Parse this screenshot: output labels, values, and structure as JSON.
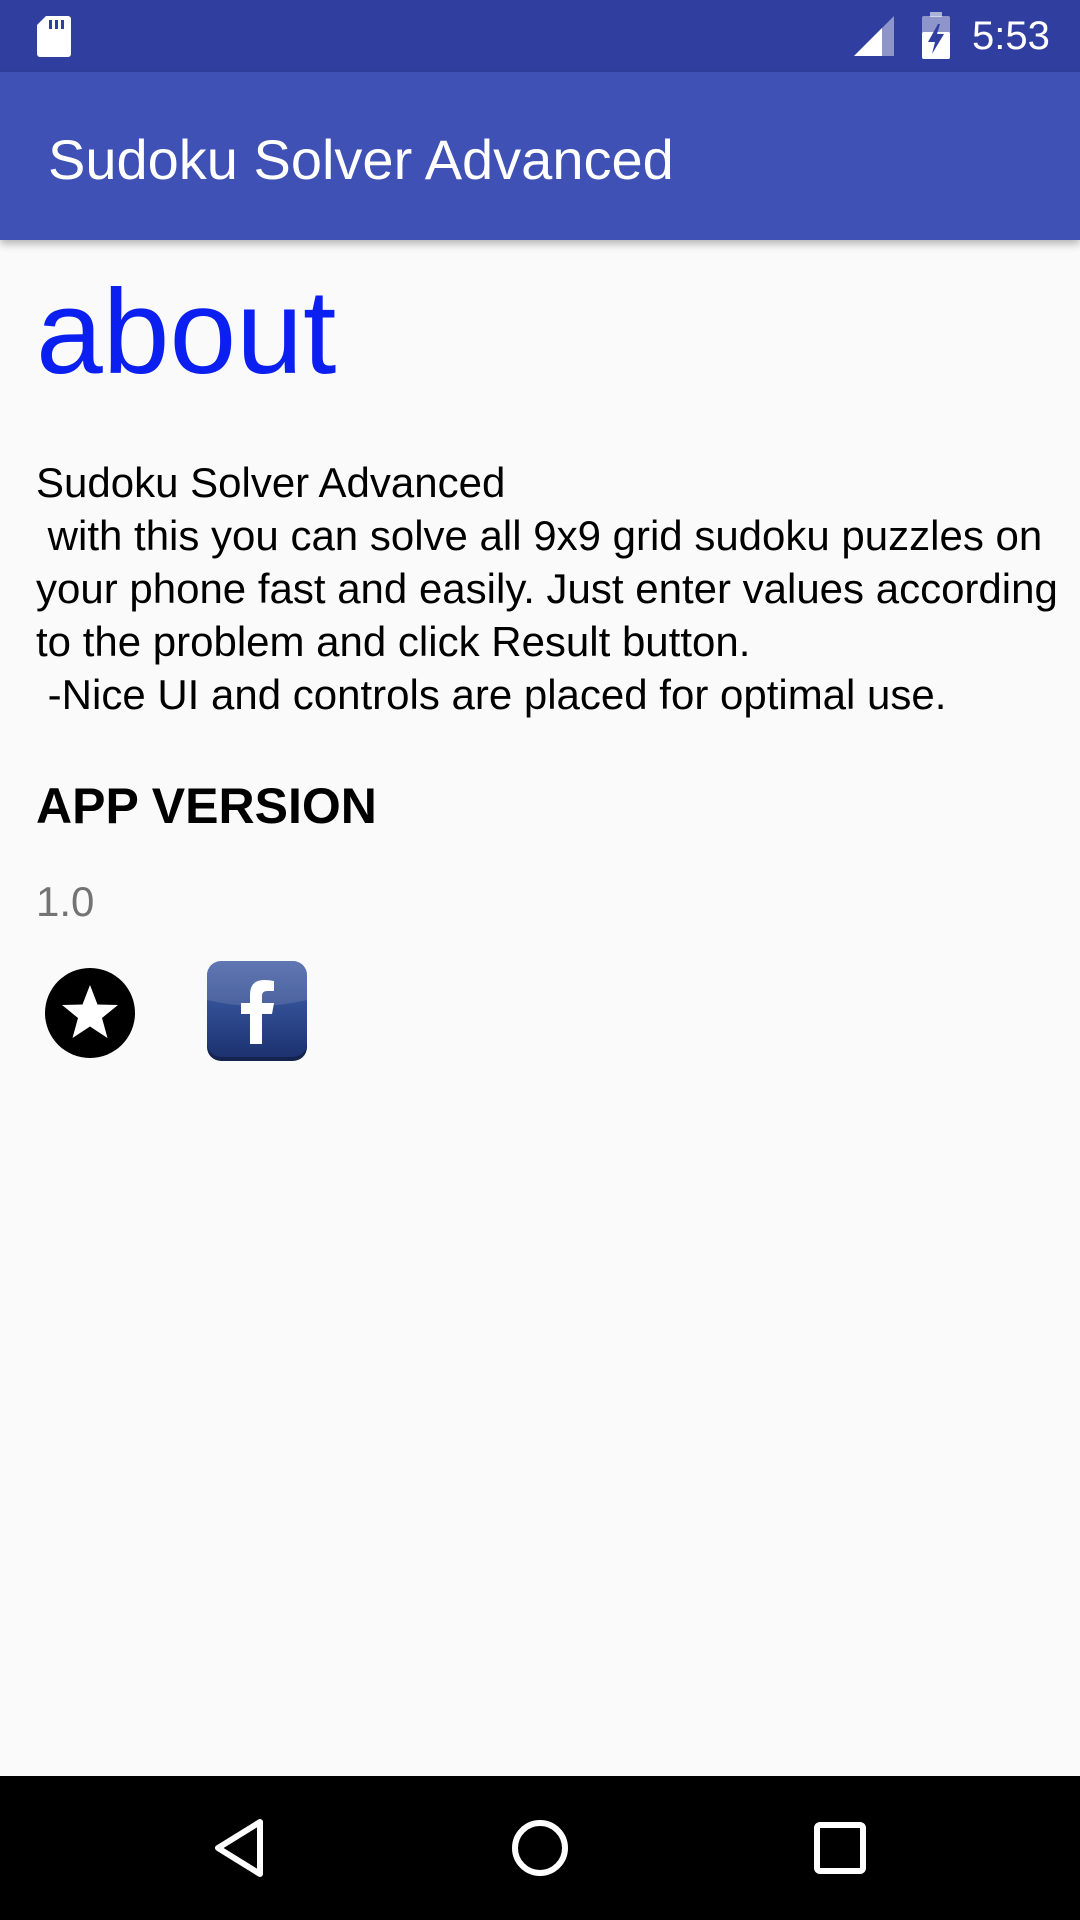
{
  "status_bar": {
    "time": "5:53",
    "icons": [
      "sd-card-icon",
      "signal-icon",
      "battery-charging-icon"
    ],
    "background_color": "#303f9f"
  },
  "app_bar": {
    "title": "Sudoku Solver Advanced",
    "background_color": "#3f51b5"
  },
  "content": {
    "heading": "about",
    "heading_color": "#0a1ff0",
    "description": "Sudoku Solver Advanced\n with this you can solve all 9x9 grid sudoku puzzles on your phone fast and easily. Just enter values according to the problem and click Result button.\n -Nice UI and controls are placed for optimal use.",
    "version_title": "APP VERSION",
    "version_value": "1.0",
    "action_icons": [
      "star-rate-icon",
      "facebook-icon"
    ]
  },
  "nav_bar": {
    "buttons": [
      "back-icon",
      "home-icon",
      "recents-icon"
    ]
  }
}
